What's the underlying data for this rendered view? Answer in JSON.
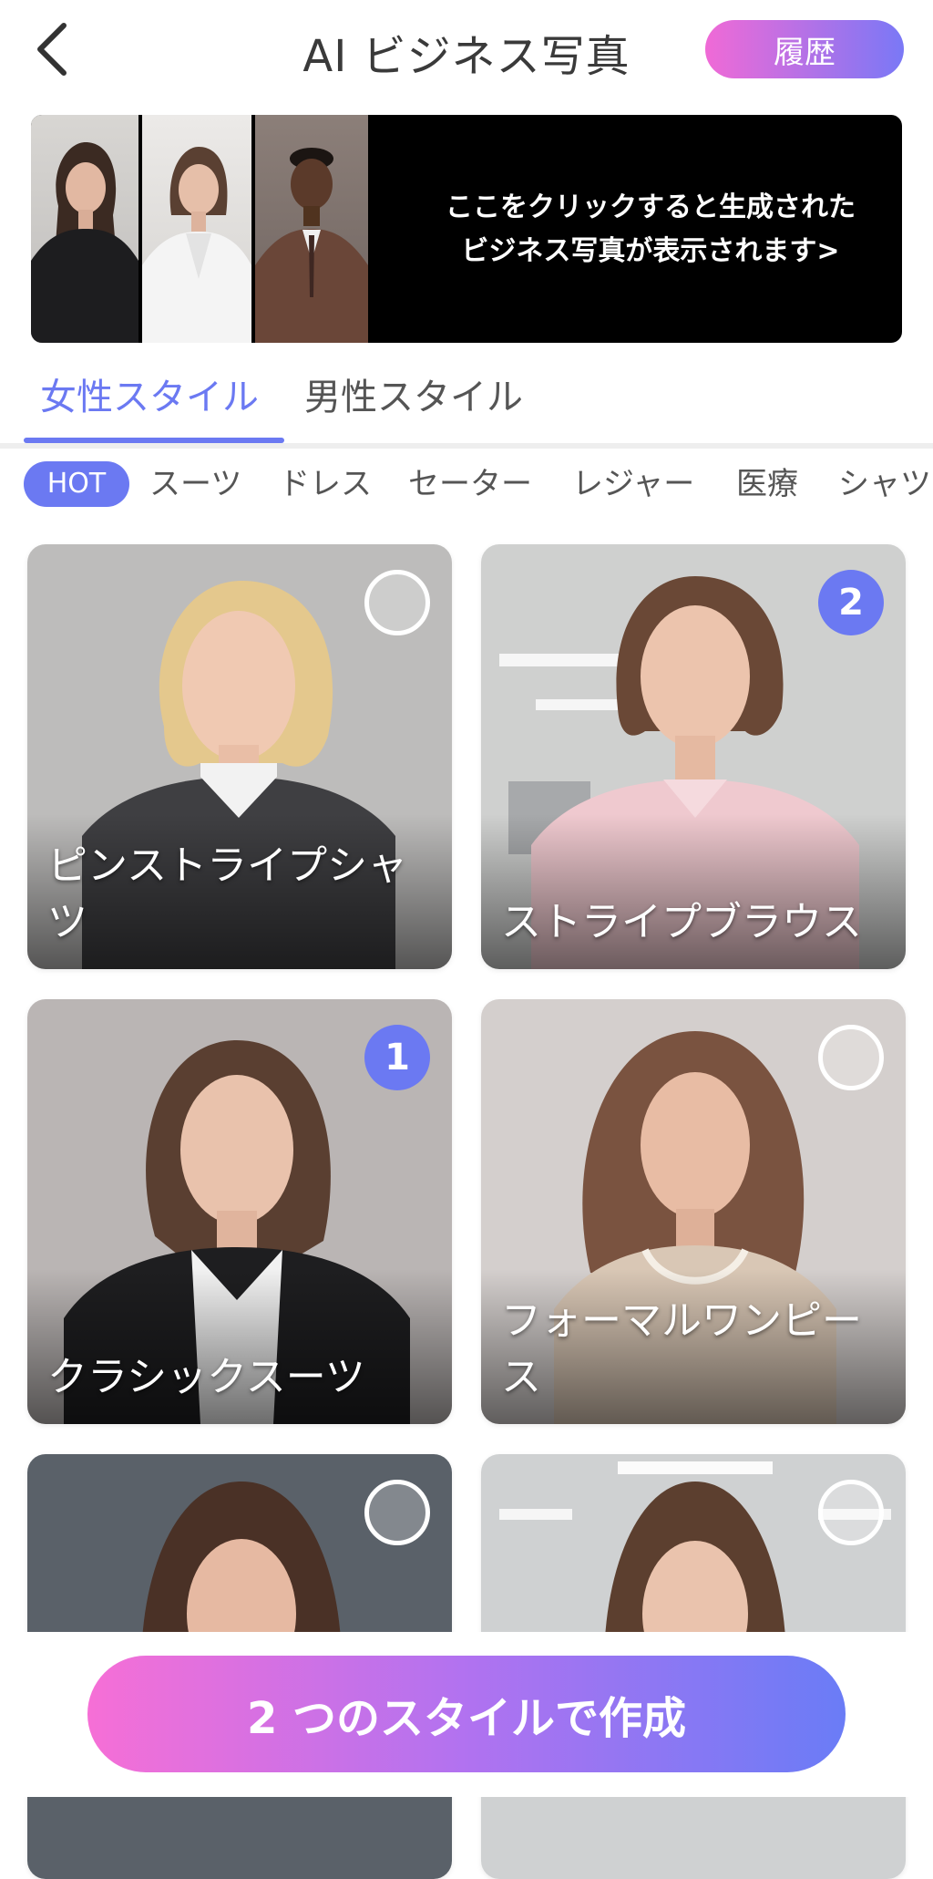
{
  "header": {
    "title": "AI ビジネス写真",
    "history_label": "履歴",
    "back_icon": "chevron-left-icon"
  },
  "banner": {
    "line1": "ここをクリックすると生成された",
    "line2": "ビジネス写真が表示されます>"
  },
  "gender_tabs": [
    {
      "label": "女性スタイル",
      "active": true
    },
    {
      "label": "男性スタイル",
      "active": false
    }
  ],
  "categories": [
    {
      "label": "HOT",
      "active": true
    },
    {
      "label": "スーツ",
      "active": false
    },
    {
      "label": "ドレス",
      "active": false
    },
    {
      "label": "セーター",
      "active": false
    },
    {
      "label": "レジャー",
      "active": false
    },
    {
      "label": "医療",
      "active": false
    },
    {
      "label": "シャツ",
      "active": false
    }
  ],
  "styles": [
    {
      "label": "ピンストライプシャツ",
      "selected": false,
      "order": ""
    },
    {
      "label": "ストライプブラウス",
      "selected": true,
      "order": "2"
    },
    {
      "label": "クラシックスーツ",
      "selected": true,
      "order": "1"
    },
    {
      "label": "フォーマルワンピース",
      "selected": false,
      "order": ""
    },
    {
      "label": "",
      "selected": false,
      "order": ""
    },
    {
      "label": "",
      "selected": false,
      "order": ""
    }
  ],
  "footer": {
    "create_label": "2 つのスタイルで作成"
  },
  "colors": {
    "accent": "#6b79f2",
    "gradient_start": "#f66fd6",
    "gradient_end": "#6a7cf6"
  }
}
